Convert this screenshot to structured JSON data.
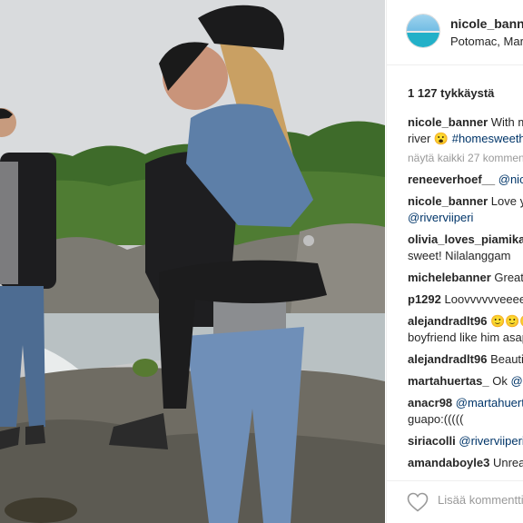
{
  "post": {
    "username": "nicole_banner",
    "location": "Potomac, Maryland",
    "likes_text": "1 127 tykkäystä",
    "view_all_text": "näytä kaikki 27 kommenttia",
    "add_comment_placeholder": "Lisää kommentti..."
  },
  "caption": {
    "user": "nicole_banner",
    "text_part1": "With my best friend at the",
    "text_part2": "river",
    "emoji": "😮",
    "hashtag": "#homesweethome"
  },
  "comments": [
    {
      "user": "reneeverhoef__",
      "mention": "@nicole_banner",
      "text": "",
      "line2": ""
    },
    {
      "user": "nicole_banner",
      "mention": "",
      "text": "Love you both",
      "line2": "@riverviiperi"
    },
    {
      "user": "olivia_loves_piamikaela",
      "mention": "",
      "text": "",
      "line2": "sweet! Nilalanggam"
    },
    {
      "user": "michelebanner",
      "mention": "",
      "text": "Great photo",
      "line2": ""
    },
    {
      "user": "p1292",
      "mention": "",
      "text": "Loovvvvvveeeee",
      "line2": ""
    },
    {
      "user": "alejandradlt96",
      "mention": "",
      "text": "🙂🙂🙂",
      "line2": "boyfriend like him asap"
    },
    {
      "user": "alejandradlt96",
      "mention": "",
      "text": "Beautiful",
      "line2": ""
    },
    {
      "user": "martahuertas_",
      "mention": "@nicole",
      "text": "Ok",
      "line2": ""
    },
    {
      "user": "anacr98",
      "mention": "@martahuertas_",
      "text": "",
      "line2": "guapo:((((("
    },
    {
      "user": "siriacolli",
      "mention": "@riverviiperi",
      "text": "",
      "line2": ""
    },
    {
      "user": "amandaboyle3",
      "mention": "",
      "text": "Unreal",
      "line2": ""
    }
  ],
  "icons": {
    "heart": "heart-outline-icon"
  },
  "colors": {
    "link": "#003569",
    "muted": "#999999",
    "border": "#efefef"
  }
}
